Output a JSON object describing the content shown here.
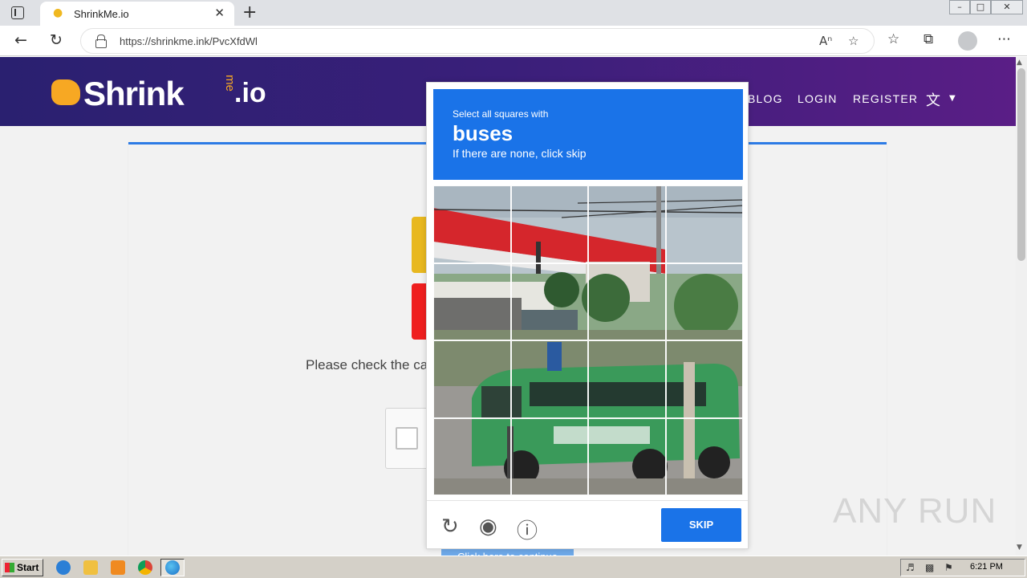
{
  "browser": {
    "tab_title": "ShrinkMe.io",
    "url": "https://shrinkme.ink/PvcXfdWl"
  },
  "site": {
    "logo_main": "Shrink",
    "logo_me": "me",
    "logo_tld": ".io",
    "nav": [
      "BLOG",
      "LOGIN",
      "REGISTER"
    ],
    "message": "Please check the ca",
    "continue_label": "Click here to continue"
  },
  "captcha": {
    "prompt_small": "Select all squares with",
    "prompt_target": "buses",
    "prompt_sub": "If there are none, click skip",
    "grid_rows": 4,
    "grid_cols": 4,
    "skip_label": "SKIP"
  },
  "watermark": "ANY RUN",
  "taskbar": {
    "start_label": "Start",
    "clock": "6:21 PM"
  },
  "colors": {
    "header_start": "#2a2070",
    "header_end": "#5a1e86",
    "captcha_blue": "#1a73e8",
    "card_accent": "#2d7be5"
  }
}
